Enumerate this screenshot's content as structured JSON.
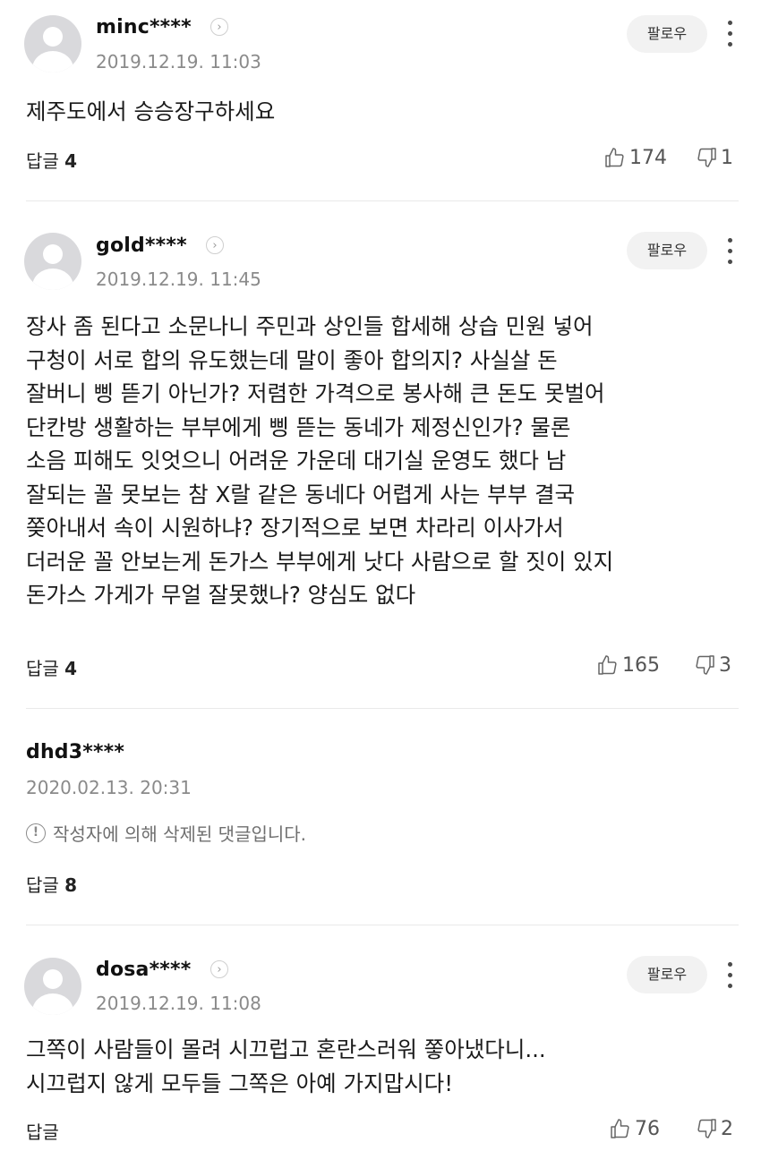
{
  "comments": [
    {
      "username": "minc****",
      "date": "2019.12.19. 11:03",
      "follow_label": "팔로우",
      "text": "제주도에서 승승장구하세요",
      "reply_label": "답글",
      "reply_count": "4",
      "likes": "174",
      "dislikes": "1"
    },
    {
      "username": "gold****",
      "date": "2019.12.19. 11:45",
      "follow_label": "팔로우",
      "text": "장사 좀 된다고 소문나니 주민과 상인들 합세해 상습 민원 넣어\n구청이 서로 합의 유도했는데 말이 좋아 합의지? 사실살 돈\n잘버니 삥 뜯기 아닌가? 저렴한 가격으로 봉사해 큰 돈도 못벌어\n단칸방 생활하는 부부에게 삥 뜯는 동네가 제정신인가? 물론\n소음 피해도 잇엇으니 어려운 가운데 대기실 운영도 했다 남\n잘되는 꼴 못보는 참 X랄 같은 동네다 어렵게 사는 부부 결국\n쫒아내서 속이 시원하냐? 장기적으로 보면 차라리 이사가서\n더러운 꼴 안보는게 돈가스 부부에게 낫다 사람으로 할 짓이 있지\n돈가스 가게가 무얼 잘못했나? 양심도 없다",
      "reply_label": "답글",
      "reply_count": "4",
      "likes": "165",
      "dislikes": "3"
    },
    {
      "username": "dhd3****",
      "date": "2020.02.13. 20:31",
      "deleted_notice": "작성자에 의해 삭제된 댓글입니다.",
      "reply_label": "답글",
      "reply_count": "8"
    },
    {
      "username": "dosa****",
      "date": "2019.12.19. 11:08",
      "follow_label": "팔로우",
      "text": "그쪽이 사람들이 몰려 시끄럽고 혼란스러워 쫗아냈다니...\n시끄럽지 않게 모두들 그쪽은 아예 가지맙시다!",
      "reply_label": "답글",
      "likes": "76",
      "dislikes": "2"
    }
  ],
  "icons": {
    "profile_link": "chevron-right-icon",
    "more": "more-vertical-icon",
    "like": "thumbs-up-icon",
    "dislike": "thumbs-down-icon",
    "deleted": "exclamation-circle-icon"
  },
  "colors": {
    "text": "#1a1a1a",
    "meta": "#8a8a8a",
    "follow_bg": "#f2f2f2",
    "avatar": "#d9d9dc",
    "divider": "#e9e9e9"
  }
}
